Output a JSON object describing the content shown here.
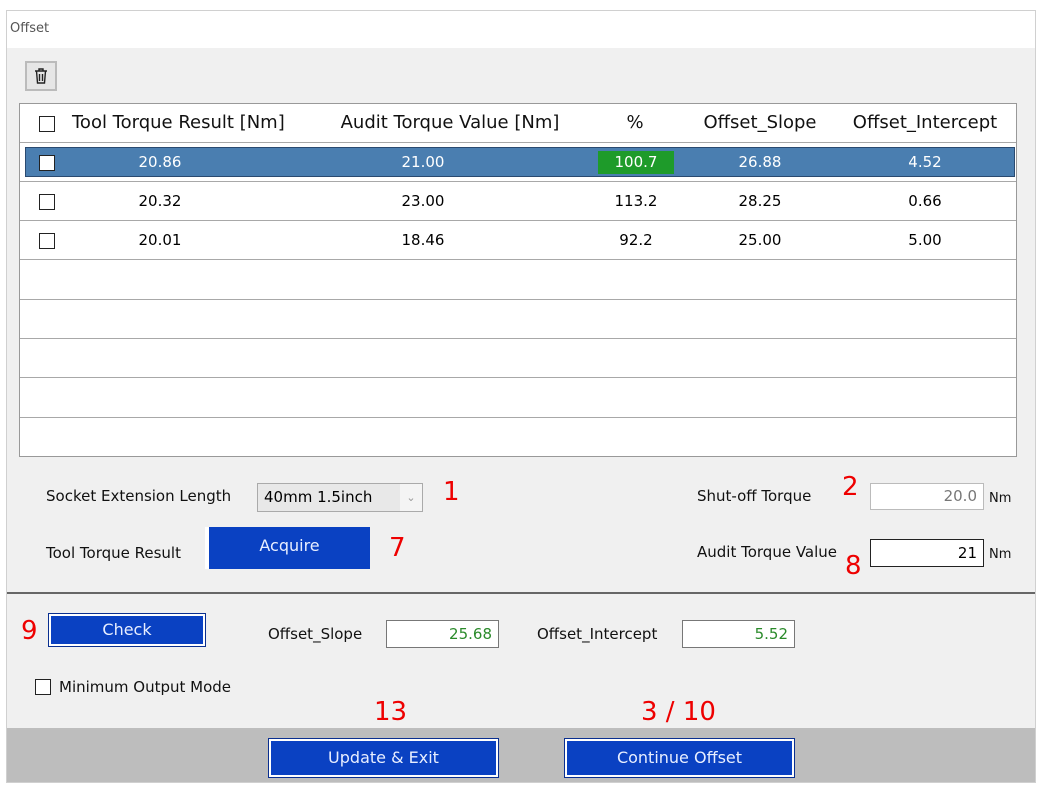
{
  "window": {
    "title": "Offset"
  },
  "table": {
    "headers": [
      "Tool Torque Result [Nm]",
      "Audit Torque Value [Nm]",
      "%",
      "Offset_Slope",
      "Offset_Intercept"
    ],
    "rows": [
      {
        "tool": "20.86",
        "audit": "21.00",
        "pct": "100.7",
        "slope": "26.88",
        "intercept": "4.52",
        "selected": true
      },
      {
        "tool": "20.32",
        "audit": "23.00",
        "pct": "113.2",
        "slope": "28.25",
        "intercept": "0.66"
      },
      {
        "tool": "20.01",
        "audit": "18.46",
        "pct": "92.2",
        "slope": "25.00",
        "intercept": "5.00"
      }
    ]
  },
  "form": {
    "socket_label": "Socket Extension Length",
    "socket_value": "40mm 1.5inch",
    "tool_result_label": "Tool Torque Result",
    "acquire": "Acquire",
    "shutoff_label": "Shut-off Torque",
    "shutoff_value": "20.0",
    "unit": "Nm",
    "audit_label": "Audit Torque Value",
    "audit_value": "21"
  },
  "check": {
    "button": "Check",
    "slope_label": "Offset_Slope",
    "slope_value": "25.68",
    "intercept_label": "Offset_Intercept",
    "intercept_value": "5.52",
    "min_mode": "Minimum Output Mode"
  },
  "footer": {
    "update": "Update & Exit",
    "continue": "Continue Offset"
  },
  "annotations": {
    "a1": "1",
    "a2": "2",
    "a7": "7",
    "a8": "8",
    "a9": "9",
    "a13": "13",
    "a3_10": "3 / 10"
  },
  "colors": {
    "accent": "#0a41c2",
    "selected": "#4a7eb0",
    "ok": "#1e9b2a",
    "annotation": "#e00000"
  }
}
